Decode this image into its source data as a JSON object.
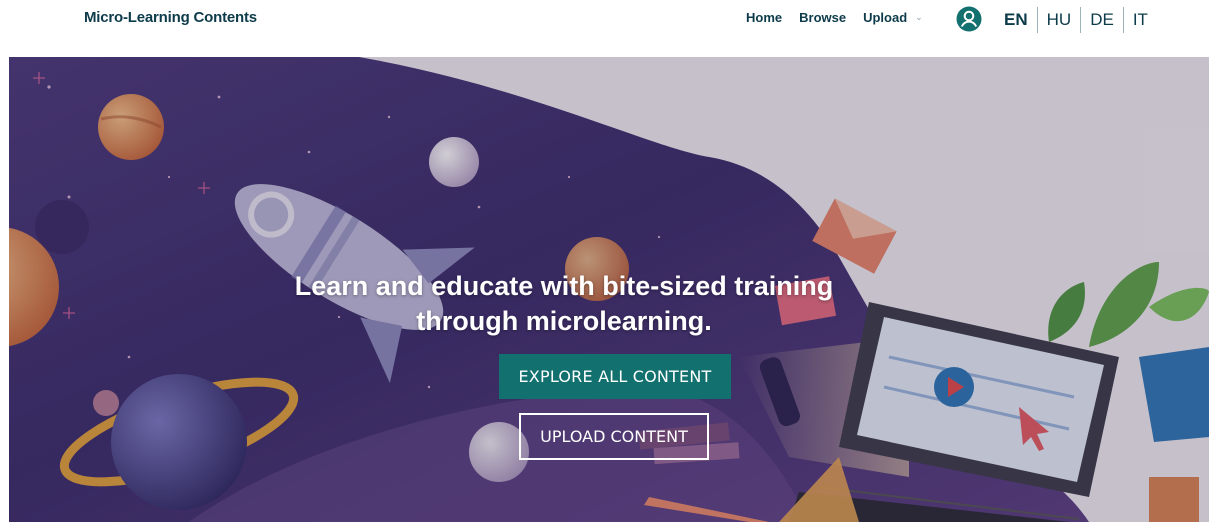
{
  "header": {
    "brand": "Micro-Learning Contents",
    "nav": {
      "home": "Home",
      "browse": "Browse",
      "upload": "Upload",
      "upload_chevron": "⌄"
    },
    "user_icon": "user-circle-icon",
    "languages": [
      "EN",
      "HU",
      "DE",
      "IT"
    ],
    "active_language": "EN"
  },
  "hero": {
    "headline_line1": "Learn and educate with bite-sized training",
    "headline_line2": "through microlearning.",
    "explore_button": "EXPLORE ALL CONTENT",
    "upload_button": "UPLOAD CONTENT",
    "illustration": "space-and-laptop-illustration"
  },
  "colors": {
    "brand_text": "#0d3b4a",
    "accent_teal": "#12706f",
    "hero_purple": "#3b2a6e"
  }
}
